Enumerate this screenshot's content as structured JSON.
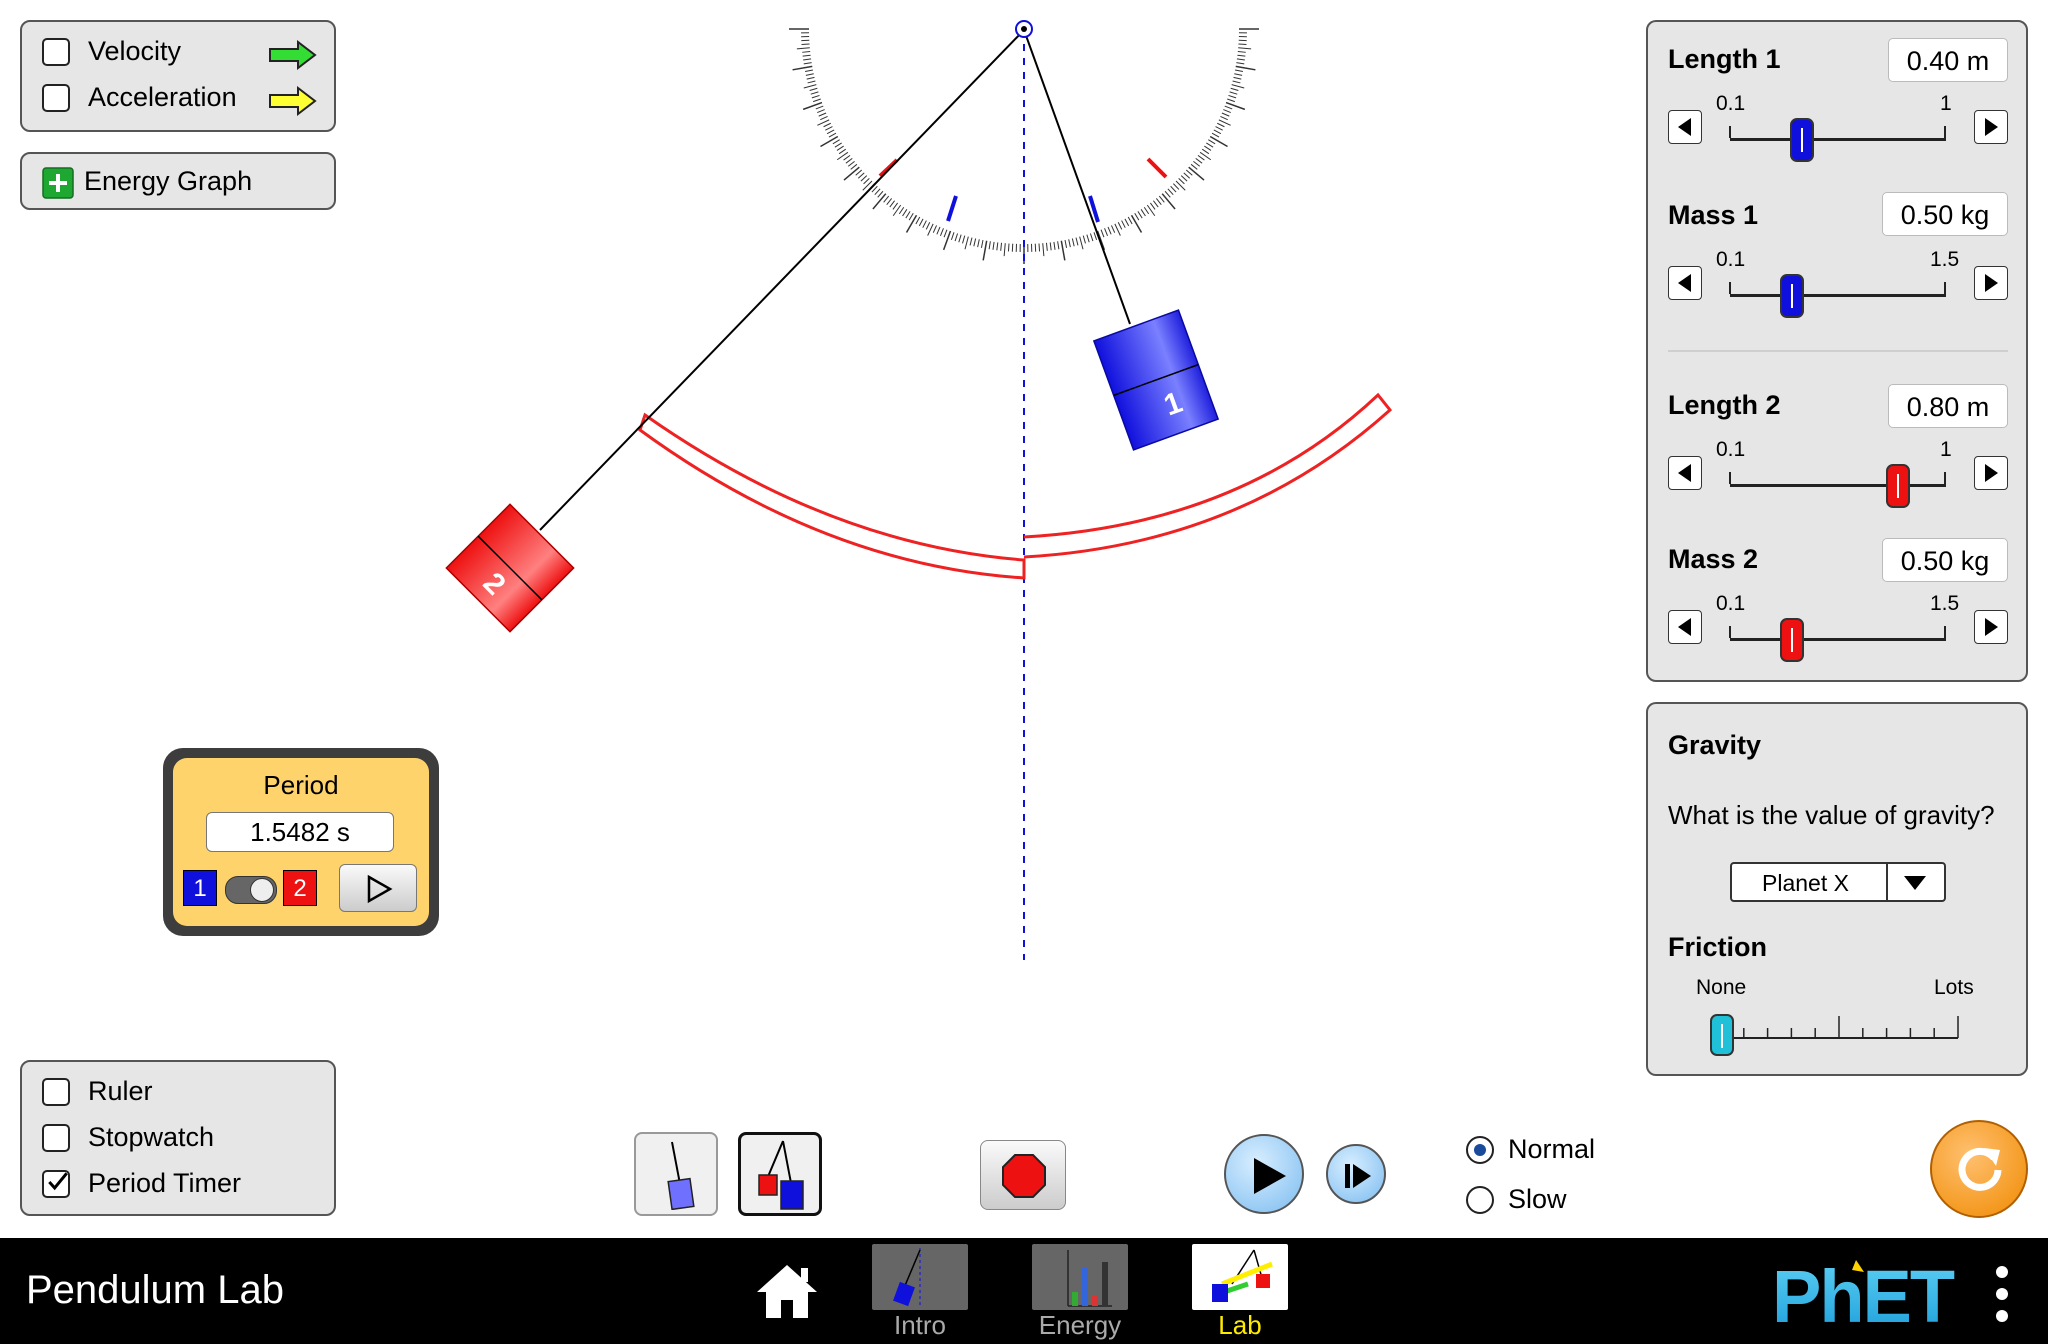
{
  "vectors": {
    "velocity_label": "Velocity",
    "velocity_checked": false,
    "acceleration_label": "Acceleration",
    "acceleration_checked": false
  },
  "energy_graph": {
    "label": "Energy Graph"
  },
  "controls": {
    "length1": {
      "label": "Length 1",
      "value": "0.40 m",
      "min": "0.1",
      "max": "1"
    },
    "mass1": {
      "label": "Mass 1",
      "value": "0.50 kg",
      "min": "0.1",
      "max": "1.5"
    },
    "length2": {
      "label": "Length 2",
      "value": "0.80 m",
      "min": "0.1",
      "max": "1"
    },
    "mass2": {
      "label": "Mass 2",
      "value": "0.50 kg",
      "min": "0.1",
      "max": "1.5"
    }
  },
  "gravity": {
    "title": "Gravity",
    "question": "What is the value of gravity?",
    "selected": "Planet X",
    "friction_title": "Friction",
    "friction_min": "None",
    "friction_max": "Lots"
  },
  "period_timer": {
    "title": "Period",
    "value": "1.5482 s",
    "pendulum1": "1",
    "pendulum2": "2"
  },
  "tools": {
    "ruler_label": "Ruler",
    "ruler_checked": false,
    "stopwatch_label": "Stopwatch",
    "stopwatch_checked": false,
    "period_timer_label": "Period Timer",
    "period_timer_checked": true
  },
  "speed": {
    "normal_label": "Normal",
    "slow_label": "Slow",
    "selected": "Normal"
  },
  "pendulums": {
    "bob1_label": "1",
    "bob2_label": "2"
  },
  "navbar": {
    "app_title": "Pendulum Lab",
    "tabs": [
      {
        "label": "Intro",
        "active": false
      },
      {
        "label": "Energy",
        "active": false
      },
      {
        "label": "Lab",
        "active": true
      }
    ],
    "brand": "PhET"
  },
  "colors": {
    "pendulum1": "#1010dd",
    "pendulum2": "#ee1111",
    "panel_bg": "#e6e6e6",
    "active_tab": "#ffeb00"
  }
}
